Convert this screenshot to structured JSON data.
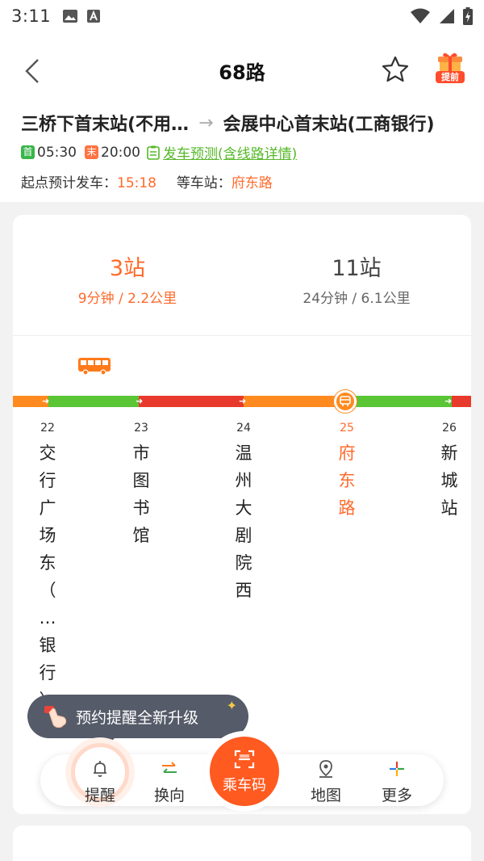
{
  "status_bar": {
    "time": "3:11"
  },
  "nav": {
    "title": "68路",
    "gift_label": "提前"
  },
  "route": {
    "from": "三桥下首末站(不用…",
    "arrow": "→",
    "to": "会展中心首末站(工商银行)",
    "first_badge": "首",
    "first_time": "05:30",
    "last_badge": "末",
    "last_time": "20:00",
    "forecast_link": "发车预测(含线路详情)",
    "depart_label": "起点预计发车：",
    "depart_time": "15:18",
    "wait_label": "等车站：",
    "wait_station": "府东路"
  },
  "arrivals": [
    {
      "stops": "3站",
      "detail": "9分钟 / 2.2公里"
    },
    {
      "stops": "11站",
      "detail": "24分钟 / 6.1公里"
    }
  ],
  "stations": [
    {
      "num": "22",
      "chars": [
        "交",
        "行",
        "广",
        "场",
        "东",
        "（",
        "…",
        "银",
        "行",
        "）"
      ]
    },
    {
      "num": "23",
      "chars": [
        "市",
        "图",
        "书",
        "馆"
      ]
    },
    {
      "num": "24",
      "chars": [
        "温",
        "州",
        "大",
        "剧",
        "院",
        "西"
      ]
    },
    {
      "num": "25",
      "chars": [
        "府",
        "东",
        "路"
      ]
    },
    {
      "num": "26",
      "chars": [
        "新",
        "城",
        "站"
      ]
    }
  ],
  "tooltip": {
    "text": "预约提醒全新升级"
  },
  "toolbar": {
    "remind": "提醒",
    "reverse": "换向",
    "qr": "乘车码",
    "map": "地图",
    "more": "更多"
  },
  "colors": {
    "accent": "#ff6a2b",
    "green": "#55b828",
    "red": "#e83a2c",
    "orange_track": "#ff8a20"
  }
}
